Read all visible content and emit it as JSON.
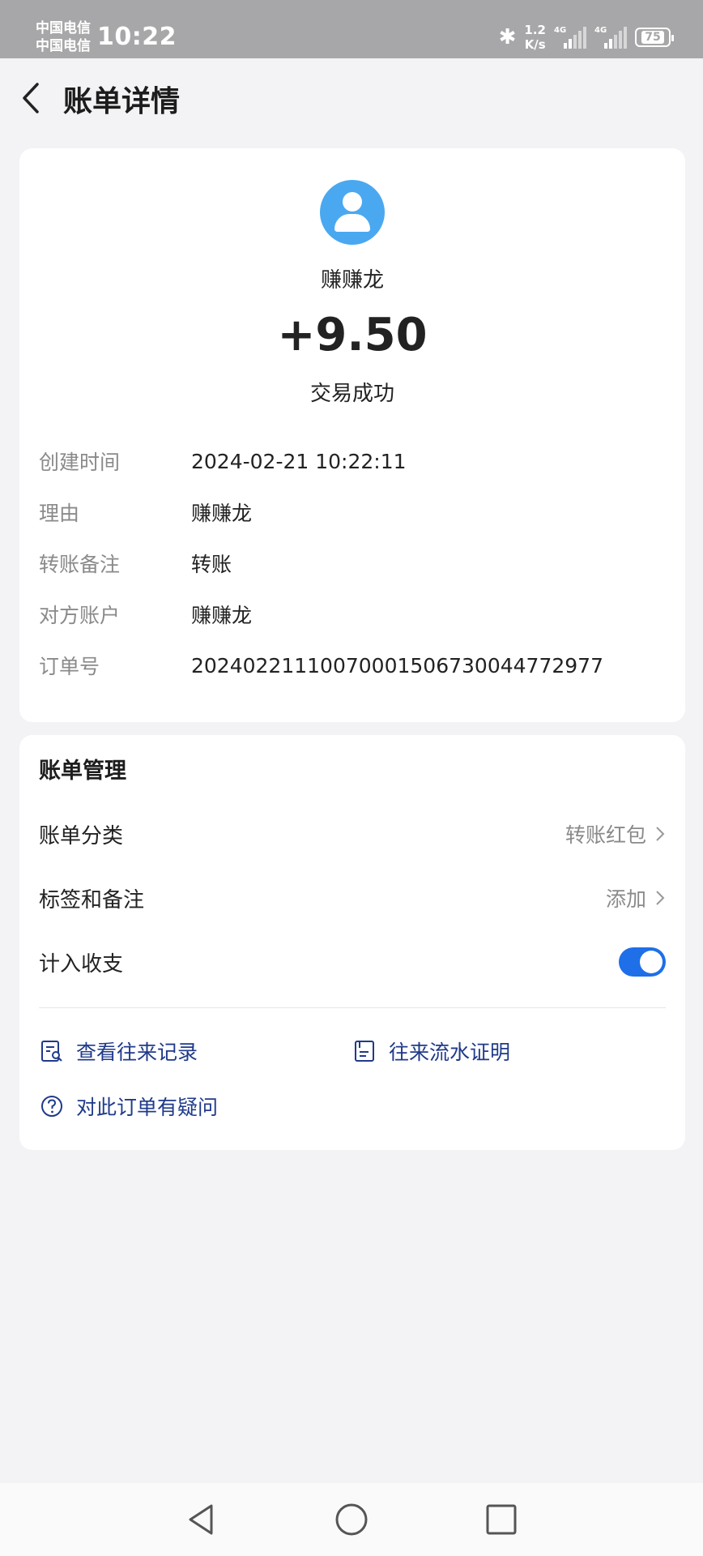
{
  "status_bar": {
    "carrier1": "中国电信",
    "carrier2": "中国电信",
    "time": "10:22",
    "speed_value": "1.2",
    "speed_unit": "K/s",
    "network1": "4G",
    "network2": "4G",
    "battery": "75"
  },
  "header": {
    "title": "账单详情"
  },
  "transaction": {
    "name": "赚赚龙",
    "amount": "+9.50",
    "status": "交易成功",
    "details": [
      {
        "label": "创建时间",
        "value": "2024-02-21 10:22:11"
      },
      {
        "label": "理由",
        "value": "赚赚龙"
      },
      {
        "label": "转账备注",
        "value": "转账"
      },
      {
        "label": "对方账户",
        "value": "赚赚龙"
      },
      {
        "label": "订单号",
        "value": "20240221110070001506730044772977"
      }
    ]
  },
  "manage": {
    "title": "账单管理",
    "category_label": "账单分类",
    "category_value": "转账红包",
    "tags_label": "标签和备注",
    "tags_value": "添加",
    "count_label": "计入收支",
    "count_enabled": true,
    "links": {
      "records": "查看往来记录",
      "proof": "往来流水证明",
      "question": "对此订单有疑问"
    }
  },
  "colors": {
    "accent": "#1e6fe8",
    "link": "#1f3a8a",
    "avatar": "#4aa8f0",
    "background": "#f3f3f5"
  }
}
